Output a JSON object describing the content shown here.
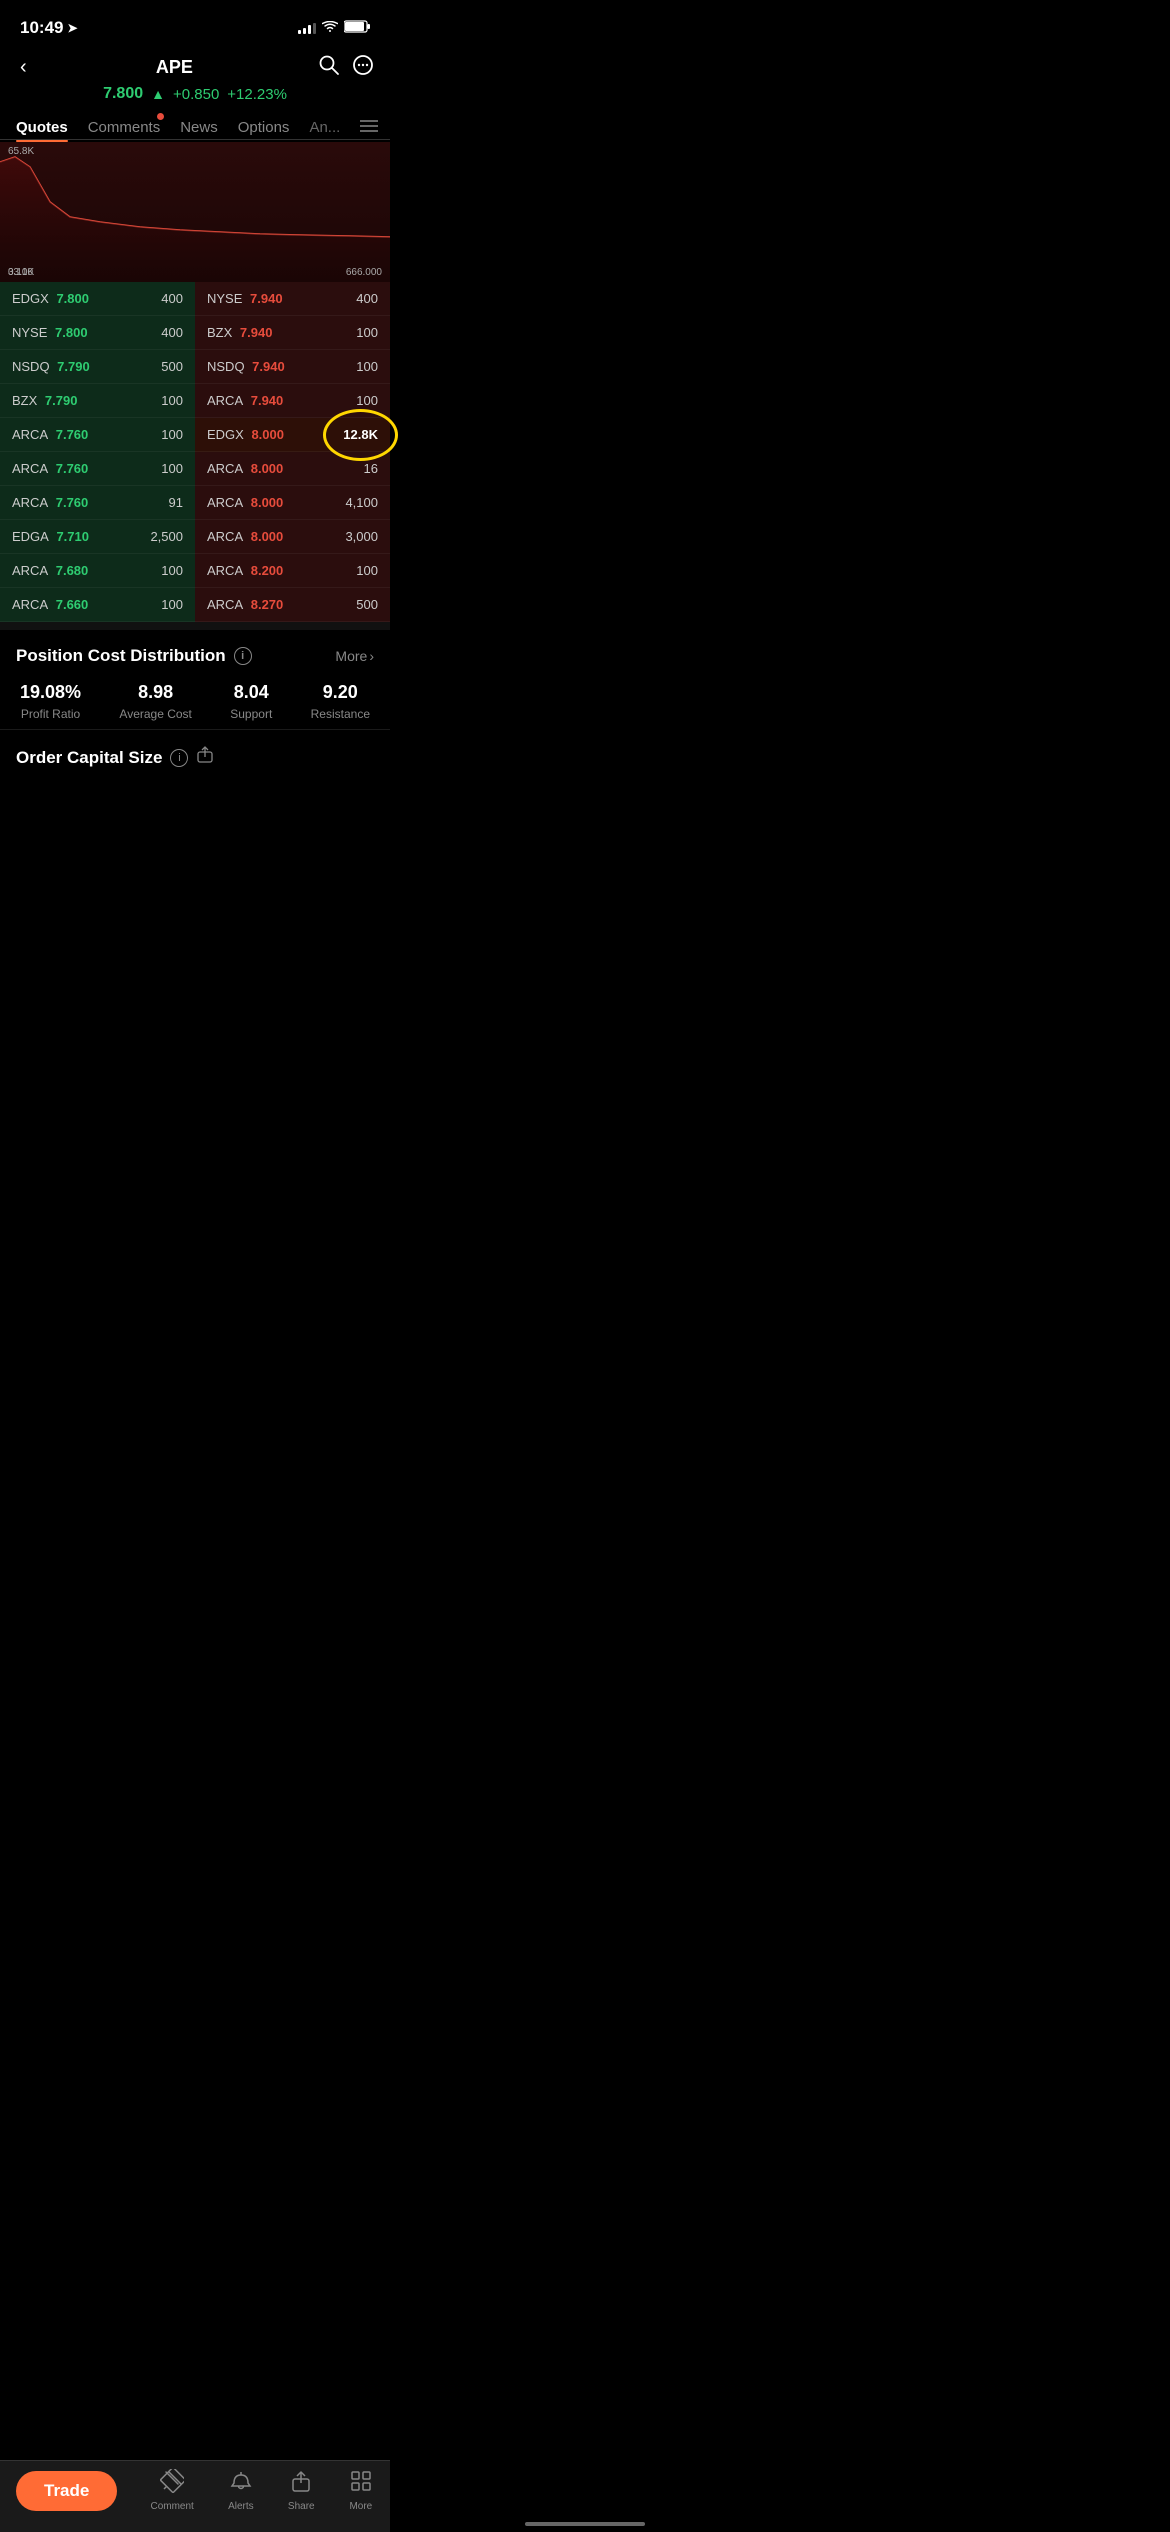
{
  "status": {
    "time": "10:49",
    "location_icon": "▶",
    "signal": [
      3,
      5,
      8,
      11
    ],
    "battery": "🔋"
  },
  "header": {
    "ticker": "APE",
    "back_label": "‹",
    "search_label": "⊙",
    "chat_label": "⊙",
    "price": "7.800",
    "change": "+0.850",
    "change_pct": "+12.23%",
    "arrow": "▲"
  },
  "tabs": [
    {
      "label": "Quotes",
      "active": true,
      "dot": false
    },
    {
      "label": "Comments",
      "active": false,
      "dot": true
    },
    {
      "label": "News",
      "active": false,
      "dot": false
    },
    {
      "label": "Options",
      "active": false,
      "dot": false
    },
    {
      "label": "An...",
      "active": false,
      "dot": false
    }
  ],
  "chart": {
    "y_labels": [
      "65.8K",
      "33.1K"
    ],
    "x_labels": [
      "0.100",
      "666.000"
    ]
  },
  "bid_rows": [
    {
      "venue": "EDGX",
      "price": "7.800",
      "size": "400"
    },
    {
      "venue": "NYSE",
      "price": "7.800",
      "size": "400"
    },
    {
      "venue": "NSDQ",
      "price": "7.790",
      "size": "500"
    },
    {
      "venue": "BZX",
      "price": "7.790",
      "size": "100"
    },
    {
      "venue": "ARCA",
      "price": "7.760",
      "size": "100"
    },
    {
      "venue": "ARCA",
      "price": "7.760",
      "size": "100"
    },
    {
      "venue": "ARCA",
      "price": "7.760",
      "size": "91"
    },
    {
      "venue": "EDGA",
      "price": "7.710",
      "size": "2,500"
    },
    {
      "venue": "ARCA",
      "price": "7.680",
      "size": "100"
    },
    {
      "venue": "ARCA",
      "price": "7.660",
      "size": "100"
    }
  ],
  "ask_rows": [
    {
      "venue": "NYSE",
      "price": "7.940",
      "size": "400",
      "highlighted": false
    },
    {
      "venue": "BZX",
      "price": "7.940",
      "size": "100",
      "highlighted": false
    },
    {
      "venue": "NSDQ",
      "price": "7.940",
      "size": "100",
      "highlighted": false
    },
    {
      "venue": "ARCA",
      "price": "7.940",
      "size": "100",
      "highlighted": false
    },
    {
      "venue": "EDGX",
      "price": "8.000",
      "size": "12.8K",
      "highlighted": true
    },
    {
      "venue": "ARCA",
      "price": "8.000",
      "size": "16",
      "highlighted": false
    },
    {
      "venue": "ARCA",
      "price": "8.000",
      "size": "4,100",
      "highlighted": false
    },
    {
      "venue": "ARCA",
      "price": "8.000",
      "size": "3,000",
      "highlighted": false
    },
    {
      "venue": "ARCA",
      "price": "8.200",
      "size": "100",
      "highlighted": false
    },
    {
      "venue": "ARCA",
      "price": "8.270",
      "size": "500",
      "highlighted": false
    }
  ],
  "position": {
    "title": "Position Cost Distribution",
    "more_label": "More",
    "stats": [
      {
        "value": "19.08%",
        "label": "Profit Ratio"
      },
      {
        "value": "8.98",
        "label": "Average Cost"
      },
      {
        "value": "8.04",
        "label": "Support"
      },
      {
        "value": "9.20",
        "label": "Resistance"
      }
    ]
  },
  "order": {
    "title": "Order Capital Size"
  },
  "bottom_nav": {
    "trade_label": "Trade",
    "items": [
      {
        "icon": "✏️",
        "label": "Comment"
      },
      {
        "icon": "🔔",
        "label": "Alerts"
      },
      {
        "icon": "⬆",
        "label": "Share"
      },
      {
        "icon": "⊞",
        "label": "More"
      }
    ]
  }
}
